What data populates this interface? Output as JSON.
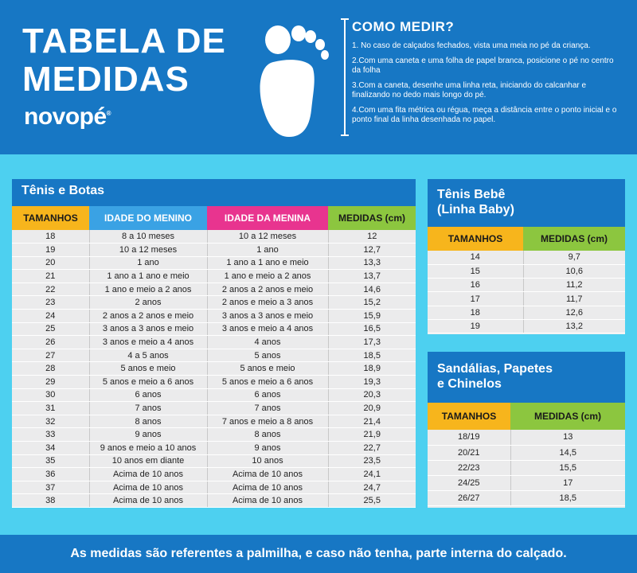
{
  "header": {
    "title_line1": "TABELA DE",
    "title_line2": "MEDIDAS",
    "brand": "novopé",
    "brand_mark": "®"
  },
  "how_to": {
    "title": "COMO MEDIR?",
    "steps": [
      "1. No caso de calçados fechados, vista uma meia no pé da criança.",
      "2.Com uma caneta e uma folha de papel branca, posicione o pé no centro da folha",
      "3.Com a caneta, desenhe uma linha reta, iniciando do calcanhar e finalizando no dedo mais longo do pé.",
      "4.Com uma fita métrica ou régua, meça a distância entre o ponto inicial e o ponto final da linha desenhada no papel."
    ]
  },
  "tenis_botas": {
    "title": "Tênis e Botas",
    "headers": [
      "TAMANHOS",
      "IDADE DO MENINO",
      "IDADE DA MENINA",
      "MEDIDAS (cm)"
    ],
    "rows": [
      [
        "18",
        "8 a 10 meses",
        "10 a 12 meses",
        "12"
      ],
      [
        "19",
        "10 a 12 meses",
        "1 ano",
        "12,7"
      ],
      [
        "20",
        "1 ano",
        "1 ano a 1 ano e meio",
        "13,3"
      ],
      [
        "21",
        "1 ano a 1 ano e meio",
        "1 ano e meio a 2 anos",
        "13,7"
      ],
      [
        "22",
        "1 ano e meio a 2 anos",
        "2 anos a 2 anos e meio",
        "14,6"
      ],
      [
        "23",
        "2 anos",
        "2 anos e meio a 3 anos",
        "15,2"
      ],
      [
        "24",
        "2 anos a 2 anos e meio",
        "3 anos a 3 anos e meio",
        "15,9"
      ],
      [
        "25",
        "3 anos a 3 anos e meio",
        "3 anos e meio a 4 anos",
        "16,5"
      ],
      [
        "26",
        "3 anos e meio a 4 anos",
        "4 anos",
        "17,3"
      ],
      [
        "27",
        "4 a 5 anos",
        "5 anos",
        "18,5"
      ],
      [
        "28",
        "5 anos e meio",
        "5 anos e meio",
        "18,9"
      ],
      [
        "29",
        "5 anos e meio a 6 anos",
        "5 anos e meio a 6 anos",
        "19,3"
      ],
      [
        "30",
        "6 anos",
        "6 anos",
        "20,3"
      ],
      [
        "31",
        "7 anos",
        "7 anos",
        "20,9"
      ],
      [
        "32",
        "8 anos",
        "7 anos e meio a 8 anos",
        "21,4"
      ],
      [
        "33",
        "9 anos",
        "8 anos",
        "21,9"
      ],
      [
        "34",
        "9 anos e meio a 10 anos",
        "9 anos",
        "22,7"
      ],
      [
        "35",
        "10 anos em diante",
        "10 anos",
        "23,5"
      ],
      [
        "36",
        "Acima de 10 anos",
        "Acima de 10 anos",
        "24,1"
      ],
      [
        "37",
        "Acima de 10 anos",
        "Acima de 10 anos",
        "24,7"
      ],
      [
        "38",
        "Acima de 10 anos",
        "Acima de 10 anos",
        "25,5"
      ]
    ]
  },
  "tenis_bebe": {
    "title_line1": "Tênis Bebê",
    "title_line2": "(Linha Baby)",
    "headers": [
      "TAMANHOS",
      "MEDIDAS (cm)"
    ],
    "rows": [
      [
        "14",
        "9,7"
      ],
      [
        "15",
        "10,6"
      ],
      [
        "16",
        "11,2"
      ],
      [
        "17",
        "11,7"
      ],
      [
        "18",
        "12,6"
      ],
      [
        "19",
        "13,2"
      ]
    ]
  },
  "sandalias": {
    "title_line1": "Sandálias, Papetes",
    "title_line2": "e Chinelos",
    "headers": [
      "TAMANHOS",
      "MEDIDAS (cm)"
    ],
    "rows": [
      [
        "18/19",
        "13"
      ],
      [
        "20/21",
        "14,5"
      ],
      [
        "22/23",
        "15,5"
      ],
      [
        "24/25",
        "17"
      ],
      [
        "26/27",
        "18,5"
      ]
    ]
  },
  "footer": {
    "note": "As medidas são referentes a palmilha, e caso não tenha, parte interna do calçado."
  },
  "colors": {
    "header_blue": "#1777c4",
    "background_cyan": "#4dd0f0",
    "orange": "#f7b51c",
    "blue": "#3aa2e4",
    "pink": "#e8348f",
    "green": "#8cc63f"
  }
}
